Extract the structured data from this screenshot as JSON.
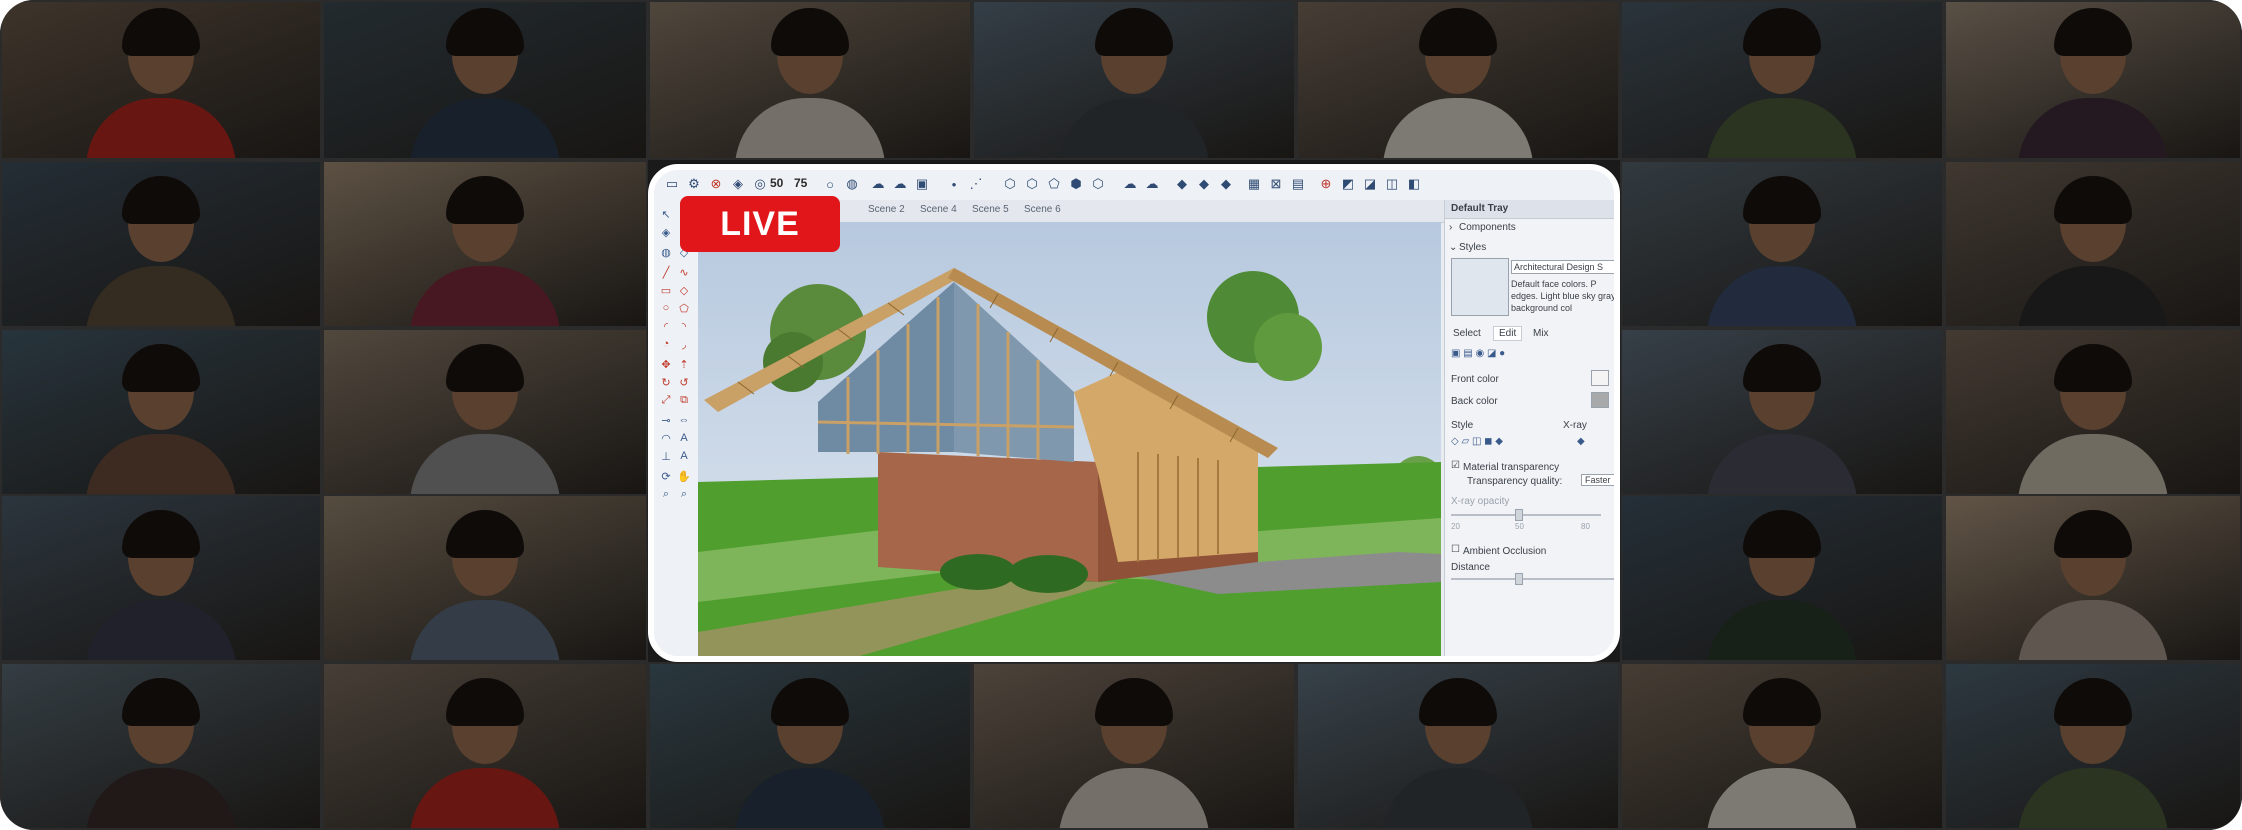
{
  "live_badge": {
    "label": "LIVE"
  },
  "participants_count": 26,
  "app": {
    "toolbar_labels": [
      "50",
      "75"
    ],
    "scene_tabs": [
      "Scene 2",
      "Scene 4",
      "Scene 5",
      "Scene 6"
    ],
    "tray": {
      "title": "Default Tray",
      "components_label": "Components",
      "styles_label": "Styles",
      "style_name": "Architectural Design S",
      "style_description": "Default face colors. P edges. Light blue sky gray background col",
      "tabs": [
        "Select",
        "Edit",
        "Mix"
      ],
      "front_color_label": "Front color",
      "back_color_label": "Back color",
      "style_label": "Style",
      "xray_label": "X-ray",
      "material_transparency_label": "Material transparency",
      "transparency_quality_label": "Transparency quality:",
      "transparency_quality_value": "Faster",
      "xray_opacity_label": "X-ray opacity",
      "slider_ticks": [
        "20",
        "50",
        "80"
      ],
      "ambient_occlusion_label": "Ambient Occlusion",
      "distance_label": "Distance"
    }
  },
  "colors": {
    "live_red": "#e0161b",
    "frame_white": "#ffffff",
    "sky": "#c3d3e6",
    "grass": "#4f9e2e",
    "roof_wood": "#c9a065",
    "brick": "#a5664a"
  }
}
